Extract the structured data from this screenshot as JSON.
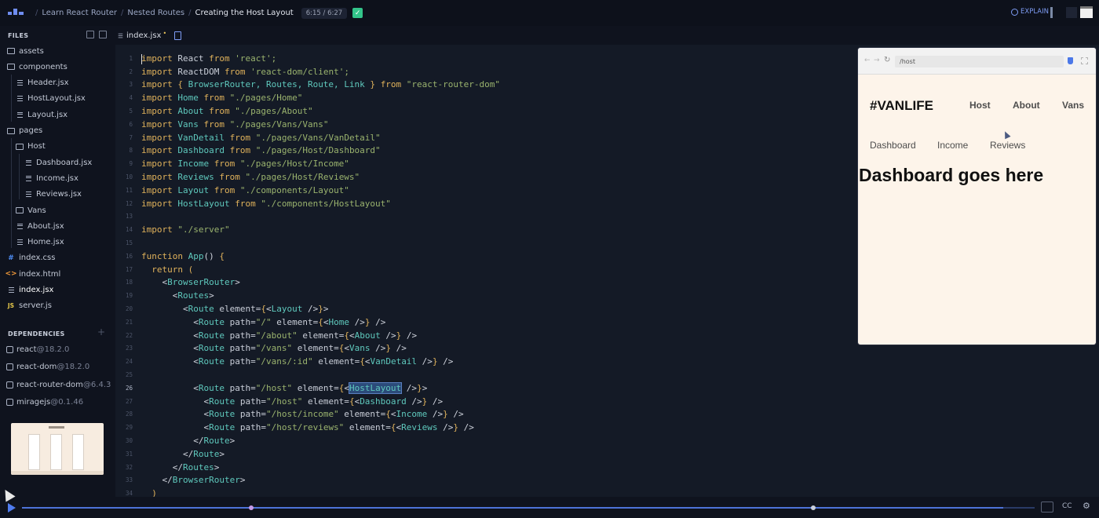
{
  "topbar": {
    "breadcrumbs": [
      "Learn React Router",
      "Nested Routes",
      "Creating the Host Layout"
    ],
    "time": "6:15 / 6:27",
    "explain_label": "EXPLAIN"
  },
  "sidebar": {
    "files_heading": "FILES",
    "tree": [
      {
        "name": "assets",
        "type": "folder",
        "depth": 0
      },
      {
        "name": "components",
        "type": "folder",
        "depth": 0
      },
      {
        "name": "Header.jsx",
        "type": "file",
        "depth": 1
      },
      {
        "name": "HostLayout.jsx",
        "type": "file",
        "depth": 1
      },
      {
        "name": "Layout.jsx",
        "type": "file",
        "depth": 1
      },
      {
        "name": "pages",
        "type": "folder",
        "depth": 0
      },
      {
        "name": "Host",
        "type": "folder",
        "depth": 1
      },
      {
        "name": "Dashboard.jsx",
        "type": "file",
        "depth": 2
      },
      {
        "name": "Income.jsx",
        "type": "file",
        "depth": 2
      },
      {
        "name": "Reviews.jsx",
        "type": "file",
        "depth": 2
      },
      {
        "name": "Vans",
        "type": "folder",
        "depth": 1
      },
      {
        "name": "About.jsx",
        "type": "file",
        "depth": 1
      },
      {
        "name": "Home.jsx",
        "type": "file",
        "depth": 1
      },
      {
        "name": "index.css",
        "type": "css",
        "depth": 0
      },
      {
        "name": "index.html",
        "type": "html",
        "depth": 0
      },
      {
        "name": "index.jsx",
        "type": "file",
        "depth": 0,
        "active": true
      },
      {
        "name": "server.js",
        "type": "js",
        "depth": 0
      }
    ],
    "dependencies_heading": "DEPENDENCIES",
    "dependencies": [
      {
        "name": "react",
        "version": "@18.2.0"
      },
      {
        "name": "react-dom",
        "version": "@18.2.0"
      },
      {
        "name": "react-router-dom",
        "version": "@6.4.3"
      },
      {
        "name": "miragejs",
        "version": "@0.1.46"
      }
    ],
    "thumbnail_title": "#VANLIFE"
  },
  "editor": {
    "tab_name": "index.jsx",
    "unsaved_marker": "•",
    "colors": {
      "keyword": "#e0b25b",
      "identifier": "#5fc9bd",
      "string": "#9ab36e",
      "punct": "#d0d4dd",
      "brace": "#e0b25b",
      "jsx": "#5fc9bd",
      "plain": "#c9ced8"
    },
    "lines": [
      [
        [
          "import",
          "keyword"
        ],
        [
          " React ",
          "plain"
        ],
        [
          "from",
          "keyword"
        ],
        [
          " 'react';",
          "string"
        ]
      ],
      [
        [
          "import",
          "keyword"
        ],
        [
          " ReactDOM ",
          "plain"
        ],
        [
          "from",
          "keyword"
        ],
        [
          " 'react-dom/client';",
          "string"
        ]
      ],
      [
        [
          "import",
          "keyword"
        ],
        [
          " { ",
          "brace"
        ],
        [
          "BrowserRouter, Routes, Route, ",
          "identifier"
        ],
        [
          "Link",
          "identifier"
        ],
        [
          " } ",
          "brace"
        ],
        [
          "from",
          "keyword"
        ],
        [
          " \"react-router-dom\"",
          "string"
        ]
      ],
      [
        [
          "import",
          "keyword"
        ],
        [
          " Home ",
          "identifier"
        ],
        [
          "from",
          "keyword"
        ],
        [
          " \"./pages/Home\"",
          "string"
        ]
      ],
      [
        [
          "import",
          "keyword"
        ],
        [
          " About ",
          "identifier"
        ],
        [
          "from",
          "keyword"
        ],
        [
          " \"./pages/About\"",
          "string"
        ]
      ],
      [
        [
          "import",
          "keyword"
        ],
        [
          " Vans ",
          "identifier"
        ],
        [
          "from",
          "keyword"
        ],
        [
          " \"./pages/Vans/Vans\"",
          "string"
        ]
      ],
      [
        [
          "import",
          "keyword"
        ],
        [
          " VanDetail ",
          "identifier"
        ],
        [
          "from",
          "keyword"
        ],
        [
          " \"./pages/Vans/VanDetail\"",
          "string"
        ]
      ],
      [
        [
          "import",
          "keyword"
        ],
        [
          " Dashboard ",
          "identifier"
        ],
        [
          "from",
          "keyword"
        ],
        [
          " \"./pages/Host/Dashboard\"",
          "string"
        ]
      ],
      [
        [
          "import",
          "keyword"
        ],
        [
          " Income ",
          "identifier"
        ],
        [
          "from",
          "keyword"
        ],
        [
          " \"./pages/Host/Income\"",
          "string"
        ]
      ],
      [
        [
          "import",
          "keyword"
        ],
        [
          " Reviews ",
          "identifier"
        ],
        [
          "from",
          "keyword"
        ],
        [
          " \"./pages/Host/Reviews\"",
          "string"
        ]
      ],
      [
        [
          "import",
          "keyword"
        ],
        [
          " Layout ",
          "identifier"
        ],
        [
          "from",
          "keyword"
        ],
        [
          " \"./components/Layout\"",
          "string"
        ]
      ],
      [
        [
          "import",
          "keyword"
        ],
        [
          " HostLayout ",
          "identifier"
        ],
        [
          "from",
          "keyword"
        ],
        [
          " \"./components/HostLayout\"",
          "string"
        ]
      ],
      [],
      [
        [
          "import",
          "keyword"
        ],
        [
          " \"./server\"",
          "string"
        ]
      ],
      [],
      [
        [
          "function",
          "keyword"
        ],
        [
          " App",
          "identifier"
        ],
        [
          "() ",
          "punct"
        ],
        [
          "{",
          "brace"
        ]
      ],
      [
        [
          "  return",
          "keyword"
        ],
        [
          " (",
          "brace"
        ]
      ],
      [
        [
          "    <",
          "punct"
        ],
        [
          "BrowserRouter",
          "jsx"
        ],
        [
          ">",
          "punct"
        ]
      ],
      [
        [
          "      <",
          "punct"
        ],
        [
          "Routes",
          "jsx"
        ],
        [
          ">",
          "punct"
        ]
      ],
      [
        [
          "        <",
          "punct"
        ],
        [
          "Route",
          "jsx"
        ],
        [
          " element=",
          "plain"
        ],
        [
          "{",
          "brace"
        ],
        [
          "<",
          "punct"
        ],
        [
          "Layout",
          "jsx"
        ],
        [
          " />",
          "punct"
        ],
        [
          "}",
          "brace"
        ],
        [
          ">",
          "punct"
        ]
      ],
      [
        [
          "          <",
          "punct"
        ],
        [
          "Route",
          "jsx"
        ],
        [
          " path=",
          "plain"
        ],
        [
          "\"/\"",
          "string"
        ],
        [
          " element=",
          "plain"
        ],
        [
          "{",
          "brace"
        ],
        [
          "<",
          "punct"
        ],
        [
          "Home",
          "jsx"
        ],
        [
          " />",
          "punct"
        ],
        [
          "}",
          "brace"
        ],
        [
          " />",
          "punct"
        ]
      ],
      [
        [
          "          <",
          "punct"
        ],
        [
          "Route",
          "jsx"
        ],
        [
          " path=",
          "plain"
        ],
        [
          "\"/about\"",
          "string"
        ],
        [
          " element=",
          "plain"
        ],
        [
          "{",
          "brace"
        ],
        [
          "<",
          "punct"
        ],
        [
          "About",
          "jsx"
        ],
        [
          " />",
          "punct"
        ],
        [
          "}",
          "brace"
        ],
        [
          " />",
          "punct"
        ]
      ],
      [
        [
          "          <",
          "punct"
        ],
        [
          "Route",
          "jsx"
        ],
        [
          " path=",
          "plain"
        ],
        [
          "\"/vans\"",
          "string"
        ],
        [
          " element=",
          "plain"
        ],
        [
          "{",
          "brace"
        ],
        [
          "<",
          "punct"
        ],
        [
          "Vans",
          "jsx"
        ],
        [
          " />",
          "punct"
        ],
        [
          "}",
          "brace"
        ],
        [
          " />",
          "punct"
        ]
      ],
      [
        [
          "          <",
          "punct"
        ],
        [
          "Route",
          "jsx"
        ],
        [
          " path=",
          "plain"
        ],
        [
          "\"/vans/:id\"",
          "string"
        ],
        [
          " element=",
          "plain"
        ],
        [
          "{",
          "brace"
        ],
        [
          "<",
          "punct"
        ],
        [
          "VanDetail",
          "jsx"
        ],
        [
          " />",
          "punct"
        ],
        [
          "}",
          "brace"
        ],
        [
          " />",
          "punct"
        ]
      ],
      [],
      [
        [
          "          <",
          "punct"
        ],
        [
          "Route",
          "jsx"
        ],
        [
          " path=",
          "plain"
        ],
        [
          "\"/host\"",
          "string"
        ],
        [
          " element=",
          "plain"
        ],
        [
          "{",
          "brace"
        ],
        [
          "<",
          "punct"
        ],
        [
          "HostLayout",
          "jsx",
          "sel"
        ],
        [
          " />",
          "punct"
        ],
        [
          "}",
          "brace"
        ],
        [
          ">",
          "punct"
        ]
      ],
      [
        [
          "            <",
          "punct"
        ],
        [
          "Route",
          "jsx"
        ],
        [
          " path=",
          "plain"
        ],
        [
          "\"/host\"",
          "string"
        ],
        [
          " element=",
          "plain"
        ],
        [
          "{",
          "brace"
        ],
        [
          "<",
          "punct"
        ],
        [
          "Dashboard",
          "jsx"
        ],
        [
          " />",
          "punct"
        ],
        [
          "}",
          "brace"
        ],
        [
          " />",
          "punct"
        ]
      ],
      [
        [
          "            <",
          "punct"
        ],
        [
          "Route",
          "jsx"
        ],
        [
          " path=",
          "plain"
        ],
        [
          "\"/host/income\"",
          "string"
        ],
        [
          " element=",
          "plain"
        ],
        [
          "{",
          "brace"
        ],
        [
          "<",
          "punct"
        ],
        [
          "Income",
          "jsx"
        ],
        [
          " />",
          "punct"
        ],
        [
          "}",
          "brace"
        ],
        [
          " />",
          "punct"
        ]
      ],
      [
        [
          "            <",
          "punct"
        ],
        [
          "Route",
          "jsx"
        ],
        [
          " path=",
          "plain"
        ],
        [
          "\"/host/reviews\"",
          "string"
        ],
        [
          " element=",
          "plain"
        ],
        [
          "{",
          "brace"
        ],
        [
          "<",
          "punct"
        ],
        [
          "Reviews",
          "jsx"
        ],
        [
          " />",
          "punct"
        ],
        [
          "}",
          "brace"
        ],
        [
          " />",
          "punct"
        ]
      ],
      [
        [
          "          </",
          "punct"
        ],
        [
          "Route",
          "jsx"
        ],
        [
          ">",
          "punct"
        ]
      ],
      [
        [
          "        </",
          "punct"
        ],
        [
          "Route",
          "jsx"
        ],
        [
          ">",
          "punct"
        ]
      ],
      [
        [
          "      </",
          "punct"
        ],
        [
          "Routes",
          "jsx"
        ],
        [
          ">",
          "punct"
        ]
      ],
      [
        [
          "    </",
          "punct"
        ],
        [
          "BrowserRouter",
          "jsx"
        ],
        [
          ">",
          "punct"
        ]
      ],
      [
        [
          "  )",
          "brace"
        ]
      ]
    ],
    "current_line": 26
  },
  "preview": {
    "url": "/host",
    "logo": "#VANLIFE",
    "nav": [
      "Host",
      "About",
      "Vans"
    ],
    "host_nav": [
      "Dashboard",
      "Income",
      "Reviews"
    ],
    "heading": "Dashboard goes here"
  },
  "player": {
    "progress": 0.969,
    "cc_label": "CC"
  }
}
